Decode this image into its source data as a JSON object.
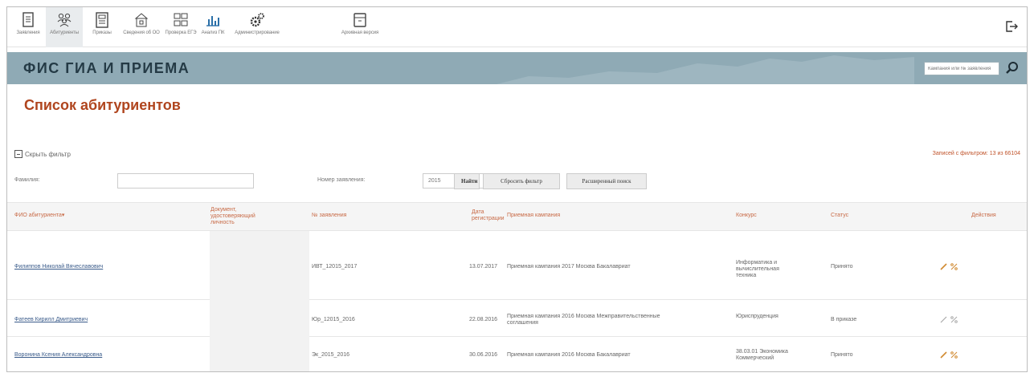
{
  "toolbar": {
    "items": [
      {
        "label": "Заявления",
        "icon": "document-icon"
      },
      {
        "label": "Абитуриенты",
        "icon": "people-icon"
      },
      {
        "label": "Приказы",
        "icon": "order-icon"
      },
      {
        "label": "Сведения об ОО",
        "icon": "building-icon"
      },
      {
        "label": "Проверка ЕГЭ",
        "icon": "grid-icon"
      },
      {
        "label": "Анализ ПК",
        "icon": "bar-chart-icon"
      },
      {
        "label": "Администрирование",
        "icon": "gears-icon"
      },
      {
        "label": "Архивная версия",
        "icon": "archive-icon"
      }
    ],
    "active_index": 1
  },
  "banner": {
    "title": "ФИС ГИА И ПРИЕМА",
    "search_placeholder": "Кампания или № заявления"
  },
  "page": {
    "title": "Список абитуриентов"
  },
  "filter": {
    "toggle_label": "Скрыть фильтр",
    "records_count": "Записей с фильтром: 13 из 66104",
    "surname_label": "Фамилия:",
    "surname_value": "",
    "application_label": "Номер заявления:",
    "application_value": "2015",
    "find_button": "Найти",
    "reset_button": "Сбросить фильтр",
    "advanced_button": "Расширенный поиск"
  },
  "table": {
    "columns": {
      "fio": "ФИО абитуриента▾",
      "document": "Документ, удостоверяющий личность",
      "app_number": "№ заявления",
      "reg_date": "Дата регистрации",
      "campaign": "Приемная кампания",
      "competition": "Конкурс",
      "status": "Статус",
      "actions": "Действия"
    },
    "rows": [
      {
        "fio": "Филиппов Николай Вячеславович",
        "document": "",
        "app_number": "ИВТ_12015_2017",
        "reg_date": "13.07.2017",
        "campaign": "Приемная кампания 2017 Москва Бакалавриат",
        "competition": "Информатика и вычислительная техника",
        "status": "Принято"
      },
      {
        "fio": "Фатеев Кирилл Дмитриевич",
        "document": "",
        "app_number": "Юр_12015_2016",
        "reg_date": "22.08.2016",
        "campaign": "Приемная кампания 2016 Москва Межправительственные соглашения",
        "competition": "Юриспруденция",
        "status": "В приказе"
      },
      {
        "fio": "Воронина Ксения Александровна",
        "document": "",
        "app_number": "Эк_2015_2016",
        "reg_date": "30.06.2016",
        "campaign": "Приемная кампания 2016 Москва Бакалавриат",
        "competition": "38.03.01 Экономика Коммерческий",
        "status": "Принято"
      }
    ]
  },
  "colors": {
    "banner": "#8faab5",
    "title_accent": "#b0451e",
    "header_text": "#c86a46",
    "link": "#3a5b8a",
    "edit_icon": "#d08a30"
  }
}
